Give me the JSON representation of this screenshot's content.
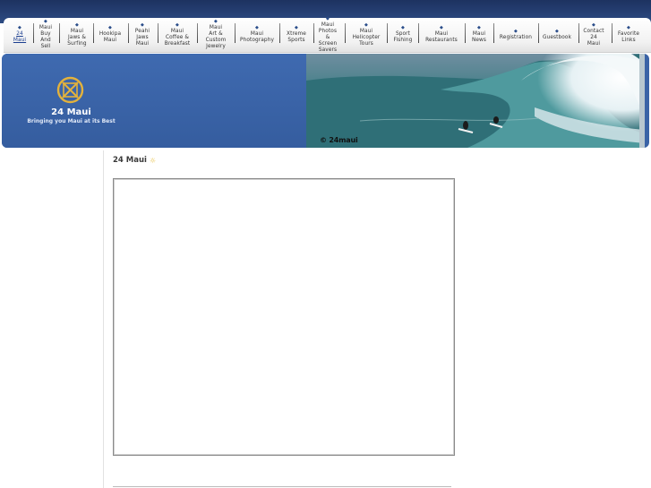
{
  "nav": {
    "items": [
      {
        "label": "24\nMaui",
        "active": true
      },
      {
        "label": "Maui\nBuy\nAnd\nSell"
      },
      {
        "label": "Maui\nJaws &\nSurfing"
      },
      {
        "label": "Hookipa\nMaui"
      },
      {
        "label": "Peahi\nJaws\nMaui"
      },
      {
        "label": "Maui\nCoffee &\nBreakfast"
      },
      {
        "label": "Maui\nArt &\nCustom\nJewelry"
      },
      {
        "label": "Maui\nPhotography"
      },
      {
        "label": "Xtreme\nSports"
      },
      {
        "label": "Maui\nPhotos\n&\nScreen\nSavers"
      },
      {
        "label": "Maui\nHelicopter\nTours"
      },
      {
        "label": "Sport\nFishing"
      },
      {
        "label": "Maui\nRestaurants"
      },
      {
        "label": "Maui\nNews"
      },
      {
        "label": "Registration"
      },
      {
        "label": "Guestbook"
      },
      {
        "label": "Contact\n24\nMaui"
      },
      {
        "label": "Favorite\nLinks"
      }
    ]
  },
  "header": {
    "site_title": "24 Maui",
    "tagline": "Bringing you Maui at its Best",
    "photo_credit": "© 24maui",
    "logo_icon": "compass-x-icon"
  },
  "main": {
    "title": "24 Maui",
    "title_icon": "sun-icon"
  },
  "colors": {
    "topbar": "#1d3260",
    "header_blue": "#3a63a6",
    "link": "#1a3d8f"
  }
}
